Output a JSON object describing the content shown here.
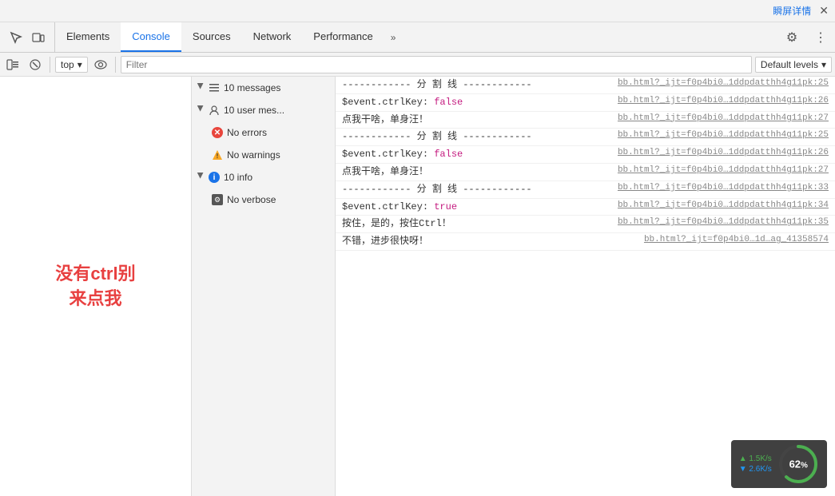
{
  "topbar": {
    "link_text": "瞬屏详情",
    "close_text": "✕"
  },
  "devtools": {
    "tabs": [
      {
        "id": "elements",
        "label": "Elements",
        "active": false
      },
      {
        "id": "console",
        "label": "Console",
        "active": true
      },
      {
        "id": "sources",
        "label": "Sources",
        "active": false
      },
      {
        "id": "network",
        "label": "Network",
        "active": false
      },
      {
        "id": "performance",
        "label": "Performance",
        "active": false
      }
    ],
    "more_icon": "»",
    "gear_icon": "⚙",
    "menu_icon": "⋮"
  },
  "toolbar": {
    "clear_icon": "🚫",
    "filter_placeholder": "Filter",
    "context_value": "top",
    "eye_icon": "👁",
    "default_levels": "Default levels",
    "dropdown_arrow": "▾"
  },
  "sidebar": {
    "items": [
      {
        "id": "messages",
        "label": "10 messages",
        "has_arrow": true,
        "icon": "list"
      },
      {
        "id": "user-messages",
        "label": "10 user mes...",
        "has_arrow": true,
        "icon": "user"
      },
      {
        "id": "errors",
        "label": "No errors",
        "icon": "error"
      },
      {
        "id": "warnings",
        "label": "No warnings",
        "icon": "warning"
      },
      {
        "id": "info",
        "label": "10 info",
        "has_arrow": true,
        "icon": "info"
      },
      {
        "id": "verbose",
        "label": "No verbose",
        "icon": "verbose"
      }
    ]
  },
  "page": {
    "text_line1": "没有ctrl别",
    "text_line2": "来点我"
  },
  "console_logs": [
    {
      "id": 1,
      "text": "------------ 分 割 线 ------------",
      "link": "bb.html?_ijt=f0p4bi0…1ddpdatthh4g11pk:25",
      "type": "normal"
    },
    {
      "id": 2,
      "text": "$event.ctrlKey:",
      "value": "false",
      "value_type": "false",
      "link": "bb.html?_ijt=f0p4bi0…1ddpdatthh4g11pk:26",
      "type": "normal"
    },
    {
      "id": 3,
      "text": "点我干啥，单身汪！",
      "link": "bb.html?_ijt=f0p4bi0…1ddpdatthh4g11pk:27",
      "type": "normal"
    },
    {
      "id": 4,
      "text": "------------ 分 割 线 ------------",
      "link": "bb.html?_ijt=f0p4bi0…1ddpdatthh4g11pk:25",
      "type": "normal"
    },
    {
      "id": 5,
      "text": "$event.ctrlKey:",
      "value": "false",
      "value_type": "false",
      "link": "bb.html?_ijt=f0p4bi0…1ddpdatthh4g11pk:26",
      "type": "normal"
    },
    {
      "id": 6,
      "text": "点我干啥，单身汪！",
      "link": "bb.html?_ijt=f0p4bi0…1ddpdatthh4g11pk:27",
      "type": "normal"
    },
    {
      "id": 7,
      "text": "------------ 分 割 线 ------------",
      "link": "bb.html?_ijt=f0p4bi0…1ddpdatthh4g11pk:33",
      "type": "normal"
    },
    {
      "id": 8,
      "text": "$event.ctrlKey:",
      "value": "true",
      "value_type": "true",
      "link": "bb.html?_ijt=f0p4bi0…1ddpdatthh4g11pk:34",
      "type": "normal"
    },
    {
      "id": 9,
      "text": "按住，是的，按住Ctrl！",
      "link": "bb.html?_ijt=f0p4bi0…1ddpdatthh4g11pk:35",
      "type": "normal"
    },
    {
      "id": 10,
      "text": "不错，进步很快呀！",
      "link": "bb.html?_ijt=f0p4bi0…1d…ag_41358574",
      "type": "normal"
    }
  ],
  "network_widget": {
    "upload_speed": "1.5K/s",
    "download_speed": "2.6K/s",
    "upload_icon": "▲",
    "download_icon": "▼",
    "progress_value": 62,
    "progress_label": "62",
    "progress_unit": "%"
  }
}
